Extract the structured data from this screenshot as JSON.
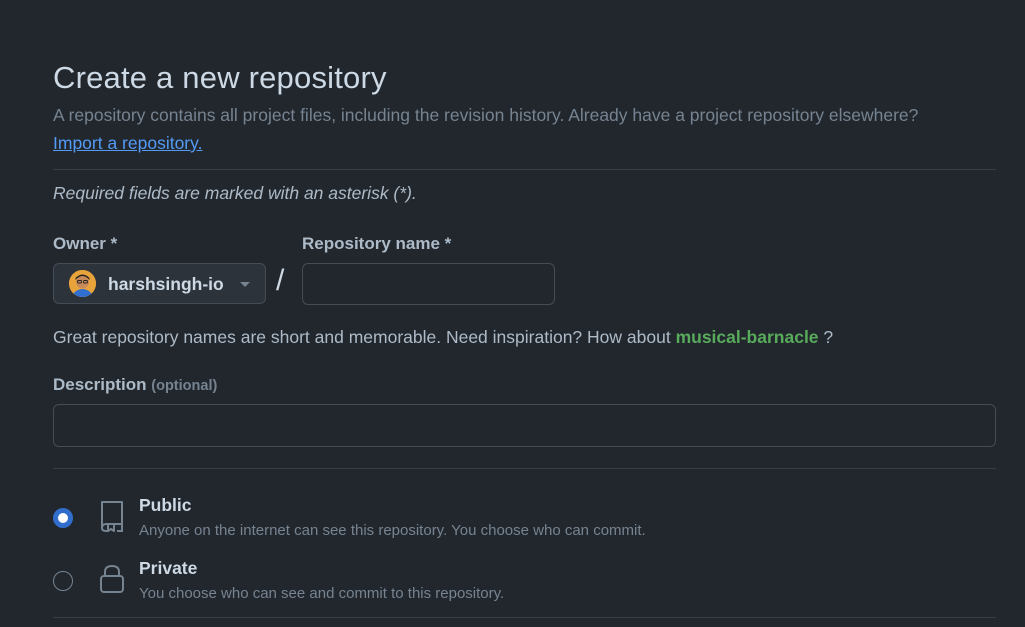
{
  "header": {
    "title": "Create a new repository",
    "subtitle": "A repository contains all project files, including the revision history. Already have a project repository elsewhere?",
    "import_link": "Import a repository."
  },
  "form": {
    "required_note": "Required fields are marked with an asterisk (*).",
    "owner": {
      "label": "Owner *",
      "value": "harshsingh-io"
    },
    "separator": "/",
    "repo_name": {
      "label": "Repository name *",
      "value": ""
    },
    "suggestion": {
      "prefix": "Great repository names are short and memorable. Need inspiration? How about",
      "name": "musical-barnacle",
      "suffix": "?"
    },
    "description": {
      "label": "Description",
      "optional": "(optional)",
      "value": ""
    },
    "visibility": [
      {
        "title": "Public",
        "description": "Anyone on the internet can see this repository. You choose who can commit.",
        "selected": true,
        "icon": "repo-icon"
      },
      {
        "title": "Private",
        "description": "You choose who can see and commit to this repository.",
        "selected": false,
        "icon": "lock-icon"
      }
    ]
  },
  "colors": {
    "background": "#22272e",
    "accent": "#316dca",
    "link": "#539bf5",
    "suggestion": "#57ab5a"
  }
}
